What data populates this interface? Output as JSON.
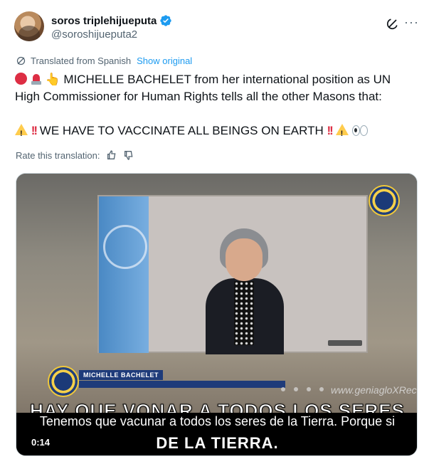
{
  "author": {
    "display_name": "soros triplehijueputa",
    "handle": "@soroshijueputa2"
  },
  "translation": {
    "notice": "Translated from Spanish",
    "show_original": "Show original",
    "rate_label": "Rate this translation:"
  },
  "tweet": {
    "line1": "MICHELLE BACHELET  from her international position as UN High Commissioner for Human Rights tells all the other Masons that:",
    "line2": "WE HAVE TO VACCINATE ALL BEINGS ON EARTH"
  },
  "icons": {
    "verified": "verified-badge-icon",
    "grok": "grok-icon",
    "more": "more-icon",
    "translate": "globe-icon",
    "thumbs_up": "thumbs-up-icon",
    "thumbs_down": "thumbs-down-icon"
  },
  "video": {
    "name_banner": "MICHELLE BACHELET",
    "watermark": "www.geniagloXReco",
    "burned_caption_top": "HAY QUE VONAR A TODOS LOS SERES",
    "subtitle": "Tenemos que vacunar a todos los seres de la Tierra. Porque si",
    "burned_caption_bottom": "DE LA TIERRA.",
    "timestamp": "0:14"
  },
  "colors": {
    "link": "#1d9bf0",
    "secondary_text": "#536471",
    "verified": "#1d9bf0"
  }
}
